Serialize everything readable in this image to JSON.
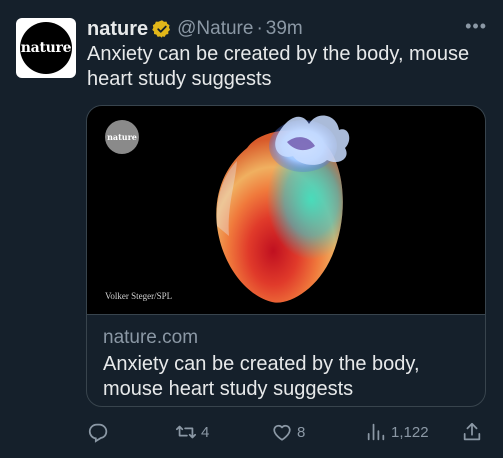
{
  "account": {
    "avatar_text": "nature",
    "name": "nature",
    "handle": "@Nature",
    "separator": "·",
    "time": "39m",
    "more_label": "•••"
  },
  "tweet": {
    "text": "Anxiety can be created by the body, mouse heart study suggests"
  },
  "card": {
    "logo_text": "nature",
    "credit": "Volker Steger/SPL",
    "domain": "nature.com",
    "title": "Anxiety can be created by the body, mouse heart study suggests"
  },
  "actions": {
    "reply_count": "",
    "retweet_count": "4",
    "like_count": "8",
    "views_count": "1,122"
  },
  "colors": {
    "background": "#15202b",
    "text": "#e7e9ea",
    "muted": "#8b98a5",
    "verified_badge": "#e2b719"
  },
  "icons": [
    "verified-icon",
    "more-icon",
    "reply-icon",
    "retweet-icon",
    "like-icon",
    "views-icon",
    "share-icon"
  ]
}
